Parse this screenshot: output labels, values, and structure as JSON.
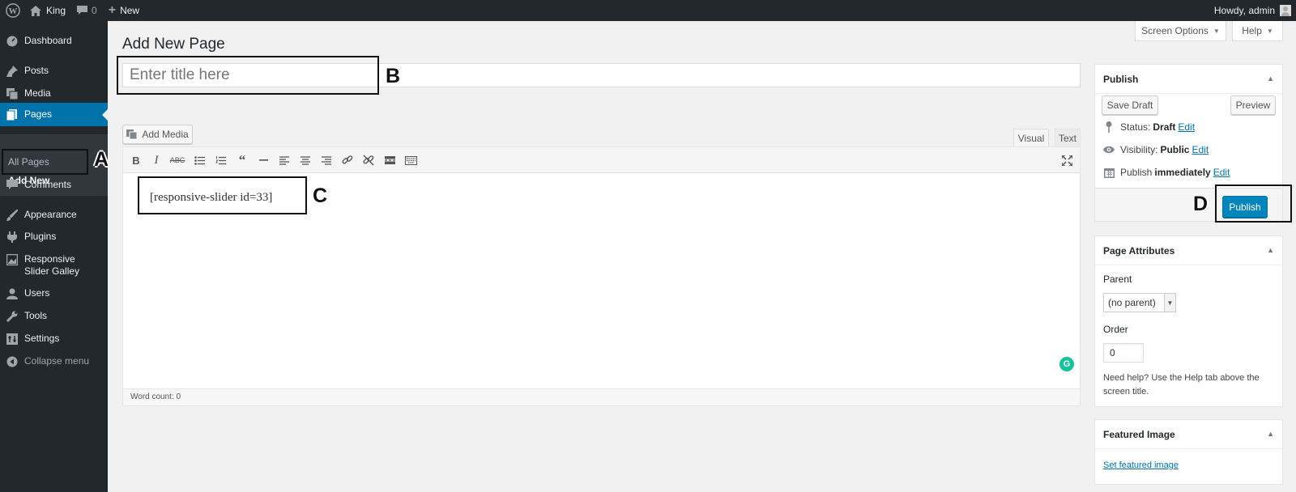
{
  "adminbar": {
    "site_name": "King",
    "comments_count": "0",
    "new_label": "New",
    "greeting": "Howdy, admin"
  },
  "sidebar": {
    "items": [
      {
        "label": "Dashboard",
        "icon": "dashboard-icon"
      },
      {
        "label": "Posts",
        "icon": "pin-icon"
      },
      {
        "label": "Media",
        "icon": "media-icon"
      },
      {
        "label": "Pages",
        "icon": "pages-icon"
      },
      {
        "label": "Comments",
        "icon": "comment-icon"
      },
      {
        "label": "Appearance",
        "icon": "brush-icon"
      },
      {
        "label": "Plugins",
        "icon": "plugin-icon"
      },
      {
        "label": "Responsive Slider Galley",
        "icon": "image-icon"
      },
      {
        "label": "Users",
        "icon": "user-icon"
      },
      {
        "label": "Tools",
        "icon": "wrench-icon"
      },
      {
        "label": "Settings",
        "icon": "settings-icon"
      },
      {
        "label": "Collapse menu",
        "icon": "collapse-icon"
      }
    ],
    "submenu": {
      "all_pages": "All Pages",
      "add_new": "Add New"
    }
  },
  "annotations": {
    "a": "A",
    "b": "B",
    "c": "C",
    "d": "D"
  },
  "header": {
    "page_title": "Add New Page",
    "screen_options": "Screen Options",
    "help": "Help"
  },
  "editor": {
    "title_placeholder": "Enter title here",
    "add_media": "Add Media",
    "tab_visual": "Visual",
    "tab_text": "Text",
    "content": "[responsive-slider id=33]",
    "word_count": "Word count: 0"
  },
  "publish_box": {
    "title": "Publish",
    "save_draft": "Save Draft",
    "preview": "Preview",
    "status_label": "Status:",
    "status_value": "Draft",
    "visibility_label": "Visibility:",
    "visibility_value": "Public",
    "publish_label": "Publish",
    "publish_value": "immediately",
    "edit": "Edit",
    "publish_button": "Publish"
  },
  "page_attributes": {
    "title": "Page Attributes",
    "parent_label": "Parent",
    "parent_value": "(no parent)",
    "order_label": "Order",
    "order_value": "0",
    "help_text": "Need help? Use the Help tab above the screen title."
  },
  "featured_image": {
    "title": "Featured Image",
    "set_link": "Set featured image"
  },
  "colors": {
    "admin_dark": "#23282d",
    "accent_blue": "#0073aa",
    "publish_blue": "#0085ba",
    "background": "#f1f1f1"
  }
}
